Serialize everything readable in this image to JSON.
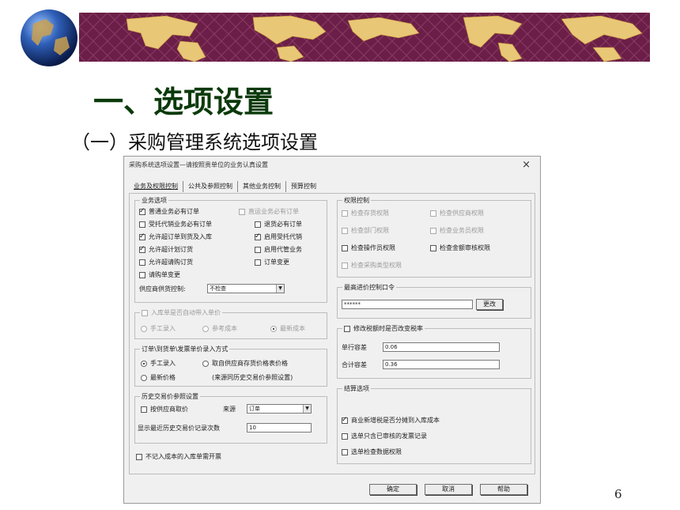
{
  "slide": {
    "title": "一、选项设置",
    "subtitle": "（一）采购管理系统选项设置",
    "page_number": "6"
  },
  "dialog": {
    "title": "采购系统选项设置—请按照贵单位的业务认真设置",
    "close_glyph": "×",
    "tabs": [
      "业务及权限控制",
      "公共及参照控制",
      "其他业务控制",
      "预算控制"
    ],
    "business_options": {
      "title": "业务选项",
      "items": [
        {
          "label": "普通业务必有订单",
          "checked": true,
          "enabled": true
        },
        {
          "label": "直运业务必有订单",
          "checked": false,
          "enabled": false
        },
        {
          "label": "受托代销业务必有订单",
          "checked": false,
          "enabled": true
        },
        {
          "label": "退货必有订单",
          "checked": false,
          "enabled": true
        },
        {
          "label": "允许超订单到货及入库",
          "checked": true,
          "enabled": true
        },
        {
          "label": "启用受托代销",
          "checked": true,
          "enabled": true
        },
        {
          "label": "允许超计划订货",
          "checked": true,
          "enabled": true
        },
        {
          "label": "启用代管业务",
          "checked": false,
          "enabled": true
        },
        {
          "label": "允许超请购订货",
          "checked": false,
          "enabled": true
        },
        {
          "label": "订单变更",
          "checked": false,
          "enabled": true
        },
        {
          "label": "请购单变更",
          "checked": false,
          "enabled": true
        }
      ],
      "supplier_control_label": "供应商供货控制:",
      "supplier_control_value": "不检查"
    },
    "inbound_price": {
      "title": "入库单是否自动带入单价",
      "options": [
        "手工录入",
        "参考成本",
        "最新成本"
      ],
      "selected": 2
    },
    "invoice_price": {
      "title": "订单\\到货单\\发票单价录入方式",
      "options": [
        "手工录入",
        "取自供应商存货价格表价格",
        "最新价格",
        "(来源同历史交易价参照设置)"
      ],
      "selected": 0
    },
    "history_price": {
      "title": "历史交易价参照设置",
      "by_supplier_label": "按供应商取价",
      "source_label": "来源",
      "source_value": "订单",
      "records_label": "显示最近历史交易价记录次数",
      "records_value": "10"
    },
    "not_in_cost_label": "不记入成本的入库单需开票",
    "permission": {
      "title": "权限控制",
      "items": [
        {
          "label": "检查存货权限",
          "checked": false,
          "enabled": false
        },
        {
          "label": "检查供应商权限",
          "checked": false,
          "enabled": false
        },
        {
          "label": "检查部门权限",
          "checked": false,
          "enabled": false
        },
        {
          "label": "检查业务员权限",
          "checked": false,
          "enabled": false
        },
        {
          "label": "检查操作员权限",
          "checked": false,
          "enabled": true
        },
        {
          "label": "检查金额审核权限",
          "checked": false,
          "enabled": true
        },
        {
          "label": "检查采购类型权限",
          "checked": false,
          "enabled": false
        }
      ]
    },
    "max_price_password": {
      "title": "最高进价控制口令",
      "value": "******",
      "change_label": "更改"
    },
    "tax_rate": {
      "label": "修改税额时是否改变税率",
      "line_tol_label": "单行容差",
      "line_tol_value": "0.06",
      "total_tol_label": "合计容差",
      "total_tol_value": "0.36"
    },
    "settlement": {
      "title": "结算选项",
      "items": [
        {
          "label": "商业新增税是否分摊到入库成本",
          "checked": true
        },
        {
          "label": "选单只含已审核的发票记录",
          "checked": false
        },
        {
          "label": "选单检查数据权限",
          "checked": false
        }
      ]
    },
    "buttons": {
      "ok": "确定",
      "cancel": "取消",
      "help": "帮助"
    }
  },
  "colors": {
    "band": "#6b1f48",
    "title_green": "#0b3a0b",
    "map_gold": "#e8c776"
  }
}
